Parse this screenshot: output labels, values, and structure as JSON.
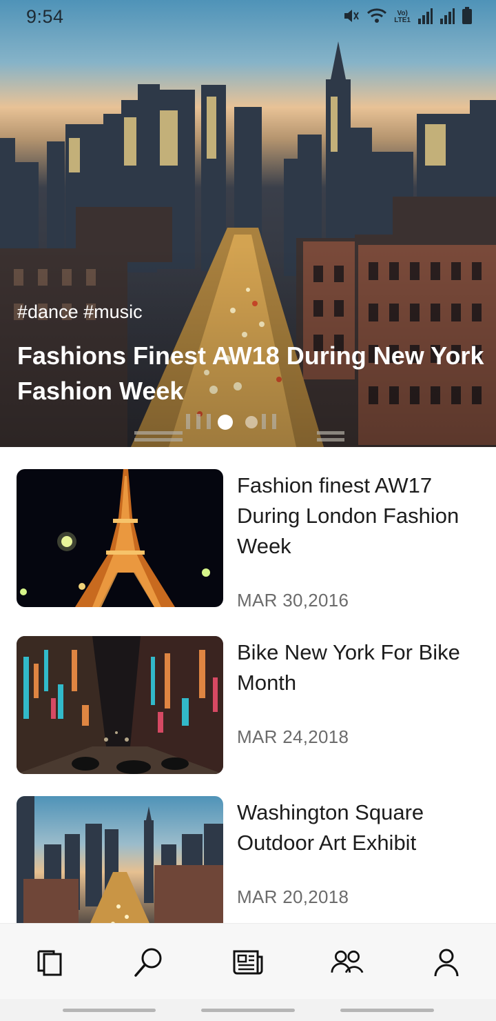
{
  "status_bar": {
    "time": "9:54",
    "network_label_top": "Vo)",
    "network_label_bottom": "LTE1"
  },
  "hero": {
    "tags": "#dance #music",
    "title": "Fashions Finest AW18 During New York Fashion Week",
    "carousel_total_slides": 2,
    "carousel_active_index": 0
  },
  "articles": [
    {
      "title": "Fashion finest AW17 During London Fashion Week",
      "date": "MAR 30,2016",
      "image": "eiffel-tower-night-photo"
    },
    {
      "title": "Bike New York For Bike Month",
      "date": "MAR 24,2018",
      "image": "neon-city-street-night-photo"
    },
    {
      "title": "Washington Square Outdoor Art Exhibit",
      "date": "MAR 20,2018",
      "image": "new-york-skyline-sunset-photo"
    }
  ],
  "bottom_nav": {
    "items": [
      {
        "name": "pages",
        "icon": "pages-icon"
      },
      {
        "name": "search",
        "icon": "search-icon"
      },
      {
        "name": "news",
        "icon": "newspaper-icon"
      },
      {
        "name": "community",
        "icon": "people-icon"
      },
      {
        "name": "profile",
        "icon": "person-icon"
      }
    ]
  },
  "colors": {
    "text_primary": "#1c1c1c",
    "text_date": "#6b6b6b",
    "hero_text": "#ffffff",
    "nav_background": "#f7f7f7"
  }
}
